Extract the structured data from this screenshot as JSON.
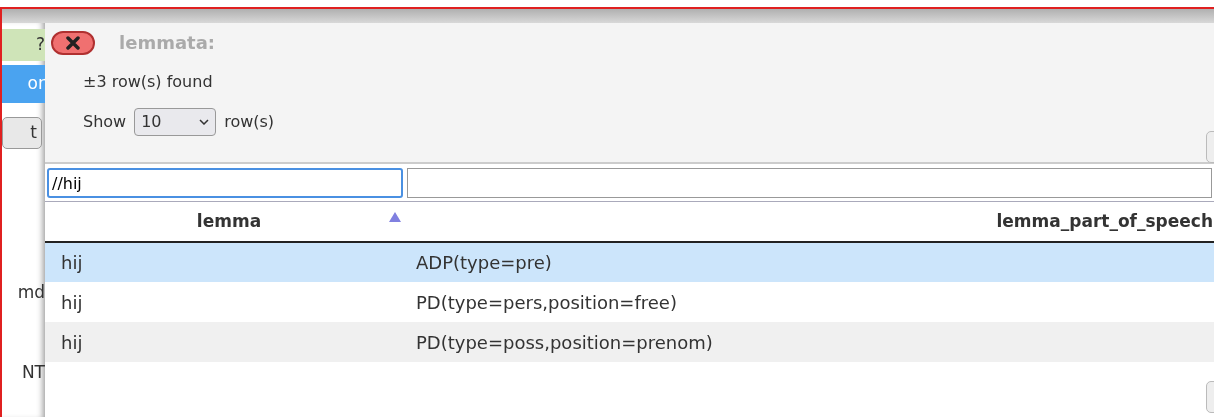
{
  "background_fragments": [
    {
      "text": "?",
      "kind": "tag"
    },
    {
      "text": "or",
      "kind": "tab"
    },
    {
      "text": "t",
      "kind": "button"
    },
    {
      "text": "md",
      "kind": "text"
    },
    {
      "text": "NT",
      "kind": "text"
    }
  ],
  "dialog": {
    "title": "lemmata:",
    "found": "±3 row(s) found",
    "show_label": "Show",
    "page_size": "10",
    "rows_label": "row(s)"
  },
  "filters": [
    {
      "value": "//hij",
      "focused": true
    },
    {
      "focused": false
    }
  ],
  "table": {
    "columns": [
      {
        "label": "lemma",
        "sorted": true
      },
      {
        "label": "lemma_part_of_speech",
        "sorted": false
      }
    ],
    "rows": [
      {
        "cells": [
          "hij",
          "ADP(type=pre)"
        ],
        "selected": true
      },
      {
        "cells": [
          "hij",
          "PD(type=pers,position=free)"
        ],
        "selected": false
      },
      {
        "cells": [
          "hij",
          "PD(type=poss,position=prenom)"
        ],
        "selected": false
      }
    ]
  }
}
